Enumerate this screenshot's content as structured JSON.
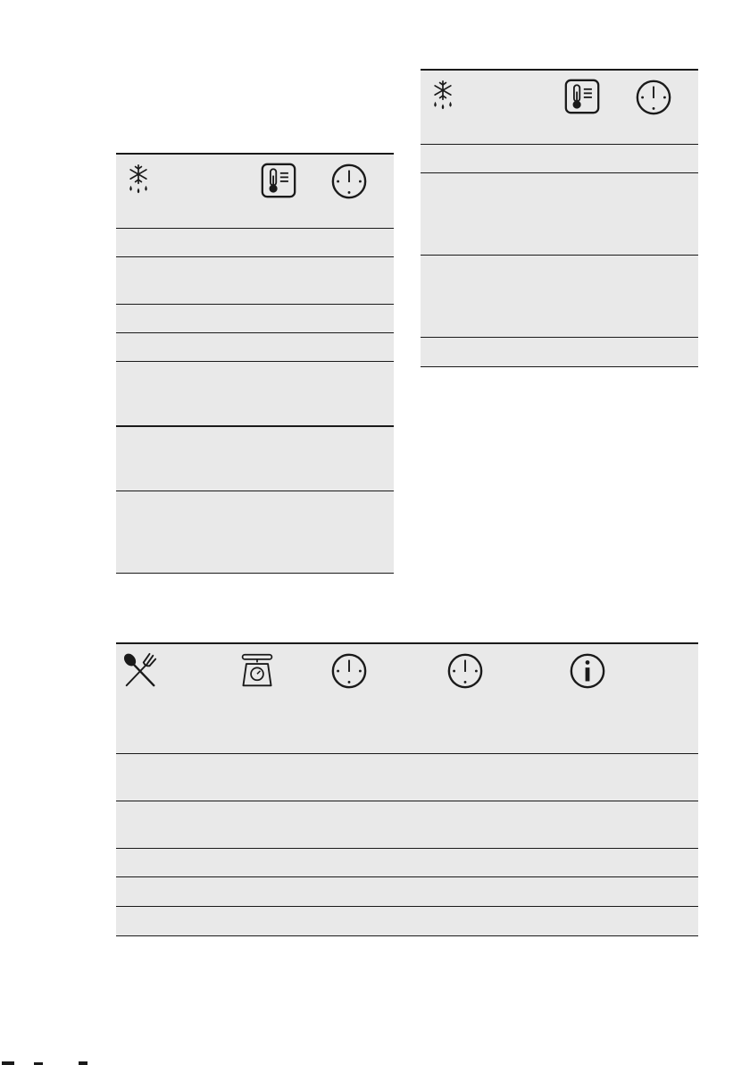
{
  "tables": {
    "defrost_left": {
      "header_icons": [
        "snowflake-drops-icon",
        "thermometer-icon",
        "clock-icon"
      ],
      "row_count": 7
    },
    "defrost_right": {
      "header_icons": [
        "snowflake-drops-icon",
        "thermometer-icon",
        "clock-icon"
      ],
      "row_count": 4
    },
    "dishes": {
      "header_icons": [
        "spoon-fork-icon",
        "kitchen-scale-icon",
        "clock-icon",
        "clock-icon",
        "info-icon"
      ],
      "row_count": 5
    }
  },
  "colors": {
    "table_fill": "#e9e9e9",
    "rule": "#1a1a1a"
  }
}
